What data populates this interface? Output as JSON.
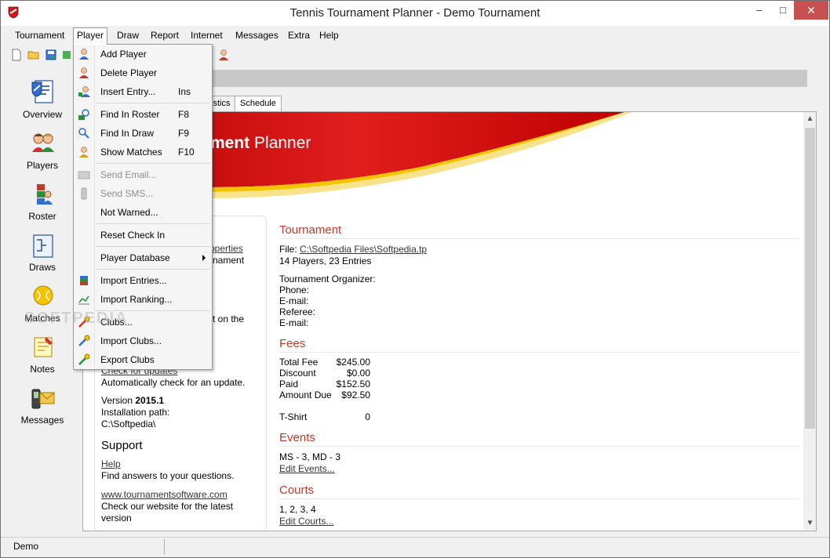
{
  "window": {
    "title": "Tennis Tournament Planner - Demo Tournament",
    "minimize": "–",
    "maximize": "□",
    "close": "✕"
  },
  "menubar": [
    "Tournament",
    "Player",
    "Draw",
    "Report",
    "Internet",
    "Messages",
    "Extra",
    "Help"
  ],
  "player_menu": {
    "items": [
      {
        "label": "Add Player",
        "key": "",
        "enabled": true
      },
      {
        "label": "Delete Player",
        "key": "",
        "enabled": true
      },
      {
        "label": "Insert Entry...",
        "key": "Ins",
        "enabled": true
      },
      {
        "label": "Find In Roster",
        "key": "F8",
        "enabled": true
      },
      {
        "label": "Find In Draw",
        "key": "F9",
        "enabled": true
      },
      {
        "label": "Show Matches",
        "key": "F10",
        "enabled": true
      },
      {
        "label": "Send Email...",
        "key": "",
        "enabled": false
      },
      {
        "label": "Send SMS...",
        "key": "",
        "enabled": false
      },
      {
        "label": "Not Warned...",
        "key": "",
        "enabled": true
      },
      {
        "label": "Reset Check In",
        "key": "",
        "enabled": true
      },
      {
        "label": "Player Database",
        "key": "",
        "enabled": true,
        "submenu": true
      },
      {
        "label": "Import Entries...",
        "key": "",
        "enabled": true
      },
      {
        "label": "Import Ranking...",
        "key": "",
        "enabled": true
      },
      {
        "label": "Clubs...",
        "key": "",
        "enabled": true
      },
      {
        "label": "Import Clubs...",
        "key": "",
        "enabled": true
      },
      {
        "label": "Export Clubs",
        "key": "",
        "enabled": true
      }
    ]
  },
  "sidebar": {
    "items": [
      {
        "label": "Overview",
        "icon": "overview-icon"
      },
      {
        "label": "Players",
        "icon": "players-icon"
      },
      {
        "label": "Roster",
        "icon": "roster-icon"
      },
      {
        "label": "Draws",
        "icon": "draws-icon"
      },
      {
        "label": "Matches",
        "icon": "matches-icon"
      },
      {
        "label": "Notes",
        "icon": "notes-icon"
      },
      {
        "label": "Messages",
        "icon": "messages-icon"
      }
    ]
  },
  "tabs": [
    "istics",
    "Schedule"
  ],
  "banner": {
    "title_bold": "ment",
    "title_rest": " Planner"
  },
  "left_panel": {
    "properties_link": "operties",
    "tournament_text": "rnament",
    "on_the_text": "t on the",
    "check_updates_link": "Check for updates",
    "auto_check": "Automatically check for an update.",
    "version_label": "Version",
    "version_value": "2015.1",
    "install_path_label": "Installation path:",
    "install_path": "C:\\Softpedia\\",
    "support_heading": "Support",
    "help_link": "Help",
    "help_desc": "Find answers to your questions.",
    "website_link": "www.tournamentsoftware.com",
    "website_desc_1": "Check our website for the latest",
    "website_desc_2": "version"
  },
  "tournament": {
    "heading": "Tournament",
    "file_label": "File:",
    "file_path": "C:\\Softpedia Files\\Softpedia.tp",
    "summary": "14 Players, 23 Entries",
    "organizer_label": "Tournament Organizer:",
    "phone_label": "Phone:",
    "email_label": "E-mail:",
    "referee_label": "Referee:",
    "referee_email_label": "E-mail:"
  },
  "fees": {
    "heading": "Fees",
    "rows": [
      {
        "label": "Total Fee",
        "value": "$245.00"
      },
      {
        "label": "Discount",
        "value": "$0.00"
      },
      {
        "label": "Paid",
        "value": "$152.50"
      },
      {
        "label": "Amount Due",
        "value": "$92.50"
      }
    ],
    "tshirt_label": "T-Shirt",
    "tshirt_value": "0"
  },
  "events": {
    "heading": "Events",
    "summary": "MS - 3, MD - 3",
    "edit_link": "Edit Events..."
  },
  "courts": {
    "heading": "Courts",
    "summary": "1, 2, 3, 4",
    "edit_link": "Edit Courts..."
  },
  "status": {
    "text": "Demo"
  },
  "watermark": "SOFTPEDIA",
  "colors": {
    "accent_red": "#c0392b",
    "banner_red": "#d11a1a",
    "banner_yellow": "#f5c400"
  }
}
